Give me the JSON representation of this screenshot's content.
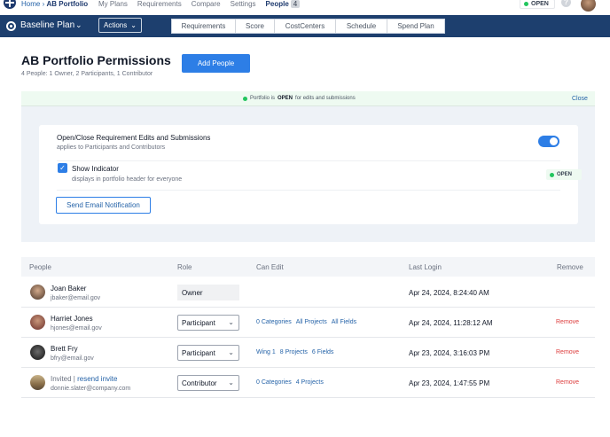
{
  "topnav": {
    "crumb_home": "Home",
    "crumb_sep": "›",
    "crumb_current": "AB Portfolio",
    "items": [
      "My Plans",
      "Requirements",
      "Compare",
      "Settings"
    ],
    "active_label": "People",
    "active_count": "4",
    "status": "OPEN",
    "help": "?"
  },
  "planbar": {
    "plan_name": "Baseline Plan",
    "actions_label": "Actions",
    "tabs": [
      "Requirements",
      "Score",
      "CostCenters",
      "Schedule",
      "Spend Plan"
    ]
  },
  "page": {
    "title": "AB Portfolio Permissions",
    "subtitle": "4 People: 1 Owner, 2 Participants, 1 Contributor",
    "add_button": "Add People"
  },
  "status_panel": {
    "prefix": "Portfolio is",
    "state": "OPEN",
    "suffix": "for edits and submissions",
    "close_label": "Close",
    "toggle_heading": "Open/Close Requirement Edits and Submissions",
    "toggle_sub": "applies to Participants and Contributors",
    "toggle_on": true,
    "indicator_label": "Show Indicator",
    "indicator_sub": "displays in portfolio header for everyone",
    "indicator_checked": true,
    "badge": "OPEN",
    "email_button": "Send Email Notification"
  },
  "table": {
    "headers": {
      "people": "People",
      "role": "Role",
      "can_edit": "Can Edit",
      "last_login": "Last Login",
      "remove": "Remove"
    },
    "rows": [
      {
        "name": "Joan Baker",
        "email": "jbaker@email.gov",
        "role": "Owner",
        "editable": false,
        "edits": [],
        "last_login": "Apr 24, 2024, 8:24:40 AM",
        "remove": ""
      },
      {
        "name": "Harriet Jones",
        "email": "hjones@email.gov",
        "role": "Participant",
        "editable": true,
        "edits": [
          "0 Categories",
          "All Projects",
          "All Fields"
        ],
        "last_login": "Apr 24, 2024, 11:28:12 AM",
        "remove": "Remove"
      },
      {
        "name": "Brett Fry",
        "email": "bfry@email.gov",
        "role": "Participant",
        "editable": true,
        "edits": [
          "Wing 1",
          "8 Projects",
          "6 Fields"
        ],
        "last_login": "Apr 23, 2024, 3:16:03 PM",
        "remove": "Remove"
      },
      {
        "name_prefix": "Invited |",
        "name_link": "resend invite",
        "email": "donnie.slater@company.com",
        "role": "Contributor",
        "editable": true,
        "edits": [
          "0 Categories",
          "4 Projects"
        ],
        "last_login": "Apr 23, 2024, 1:47:55 PM",
        "remove": "Remove"
      }
    ]
  },
  "colors": {
    "brand": "#1d3f6e",
    "accent": "#2d7ee6",
    "open": "#22c55e",
    "danger": "#dc3b3b"
  }
}
